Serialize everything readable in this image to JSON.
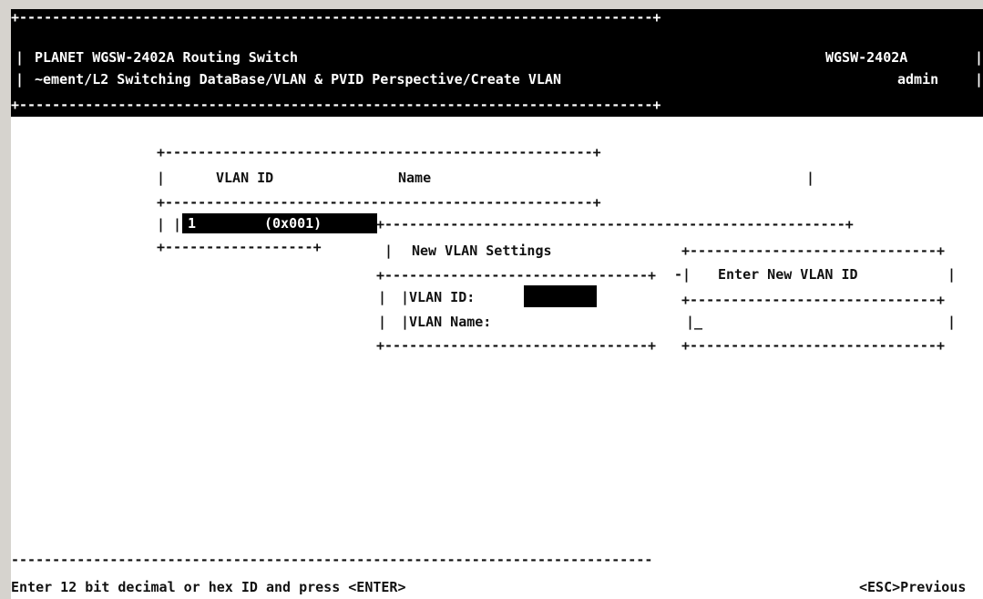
{
  "header": {
    "border": "+-----------------------------------------------------------------------------+",
    "line1_pipe": "|",
    "title": "PLANET WGSW-2402A Routing Switch",
    "model": "WGSW-2402A",
    "line2_pipe": "|",
    "path": "~ement/L2 Switching DataBase/VLAN & PVID Perspective/Create VLAN",
    "user": "admin",
    "end_pipe": "|"
  },
  "vlan_table": {
    "border_top": "+----------------------------------------------------+",
    "col_vlan_id": "VLAN ID",
    "col_name": "Name",
    "border_mid": "+----------------------------------------------------+",
    "row_id": "1",
    "row_hex": "(0x001)",
    "border_bottom": "+------------------+"
  },
  "settings_dialog": {
    "title": "New VLAN Settings",
    "border_top": "+--------------------------------------------------------+",
    "border_mid": "+--------------------------------+",
    "vlan_id_label": "|VLAN ID:",
    "vlan_name_label": "|VLAN Name:",
    "border_bottom": "+--------------------------------+"
  },
  "id_popup": {
    "border_top": "+------------------------------+",
    "title": "Enter New VLAN ID",
    "border_mid": "+------------------------------+",
    "cursor": "_",
    "border_bottom": "+------------------------------+"
  },
  "footer": {
    "divider": "------------------------------------------------------------------------------",
    "hint": "Enter 12 bit decimal or hex ID and press <ENTER>",
    "esc": "<ESC>Previous"
  }
}
